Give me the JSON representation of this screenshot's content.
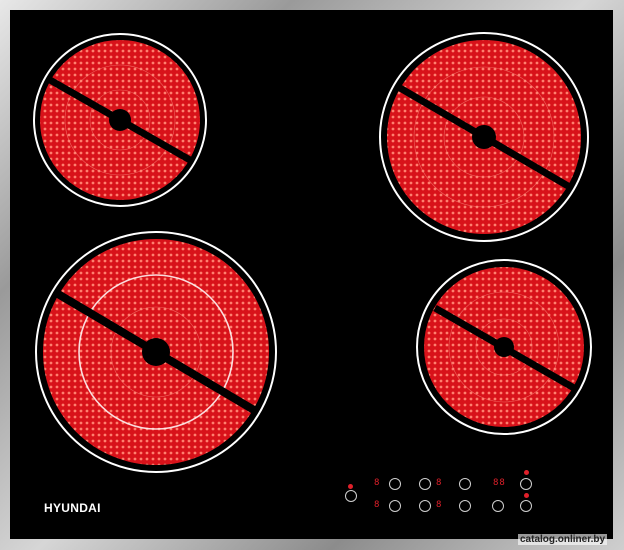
{
  "brand": {
    "name": "HYUNDAI"
  },
  "watermark": {
    "text": "catalog.onliner.by"
  },
  "colors": {
    "glass": "#000000",
    "burner": "#e8161e",
    "coil": "#ff8a80",
    "ring": "#ffffff",
    "led": "#e0202a"
  },
  "burners": [
    {
      "id": "rear-left",
      "size": "small"
    },
    {
      "id": "rear-right",
      "size": "large"
    },
    {
      "id": "front-left",
      "size": "extra-large-dual"
    },
    {
      "id": "front-right",
      "size": "medium"
    }
  ],
  "controls": {
    "display_row1": [
      "8",
      "8",
      "88"
    ],
    "display_row2": [
      "8",
      "8"
    ],
    "icons": [
      "power-icon",
      "burner-select-icon",
      "burner-select-icon",
      "plus-icon",
      "minus-icon",
      "timer-icon",
      "info-icon",
      "lock-icon"
    ]
  }
}
